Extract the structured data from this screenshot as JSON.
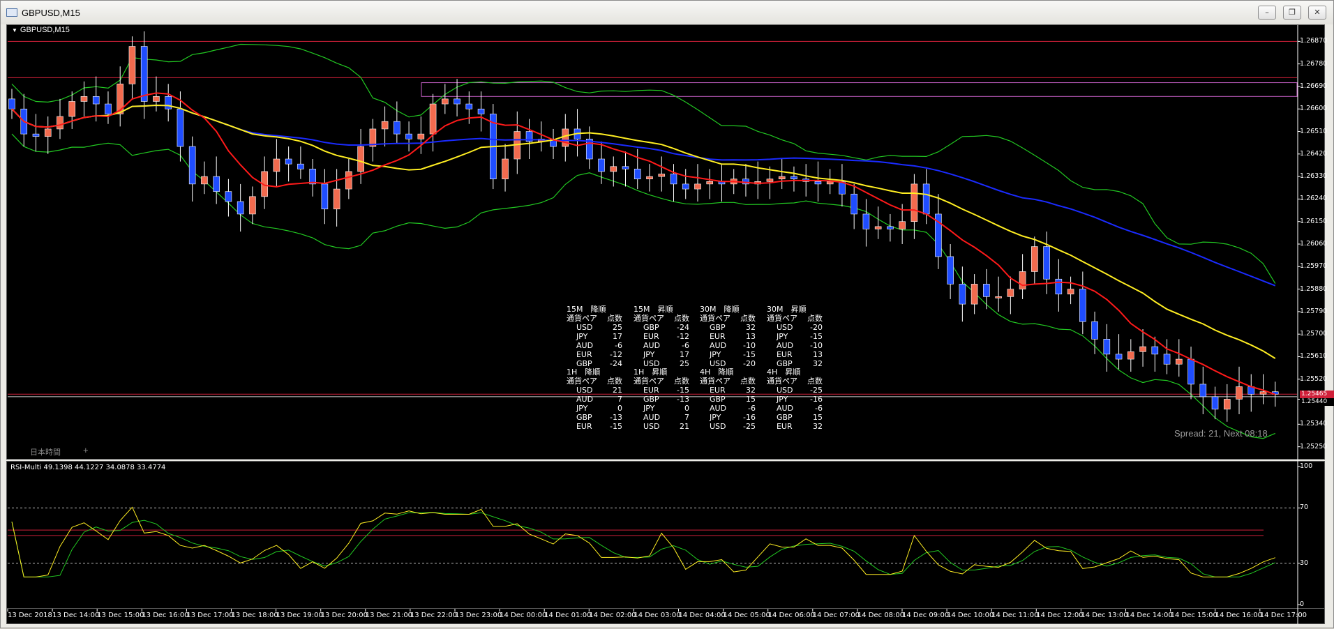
{
  "window": {
    "title": "GBPUSD,M15",
    "buttons": [
      "minimize",
      "restore",
      "close"
    ]
  },
  "chart_label": "GBPUSD,M15",
  "status_bar": {
    "tab": "日本時間",
    "plus": "+"
  },
  "spread_text": "Spread: 21, Next 08:18",
  "price_scale": [
    "1.26870",
    "1.26780",
    "1.26690",
    "1.26600",
    "1.26510",
    "1.26420",
    "1.26330",
    "1.26240",
    "1.26150",
    "1.26060",
    "1.25970",
    "1.25880",
    "1.25790",
    "1.25700",
    "1.25610",
    "1.25520",
    "1.25440",
    "1.25340",
    "1.25250"
  ],
  "price_tags": {
    "current": "1.25465",
    "bid": "1.25440"
  },
  "rsi_label": "RSI-Multi 49.1398 44.1227 34.0878 33.4774",
  "rsi_scale": [
    "100",
    "70",
    "30",
    "0"
  ],
  "time_axis": [
    "13 Dec 2018",
    "13 Dec 14:00",
    "13 Dec 15:00",
    "13 Dec 16:00",
    "13 Dec 17:00",
    "13 Dec 18:00",
    "13 Dec 19:00",
    "13 Dec 20:00",
    "13 Dec 21:00",
    "13 Dec 22:00",
    "13 Dec 23:00",
    "14 Dec 00:00",
    "14 Dec 01:00",
    "14 Dec 02:00",
    "14 Dec 03:00",
    "14 Dec 04:00",
    "14 Dec 05:00",
    "14 Dec 06:00",
    "14 Dec 07:00",
    "14 Dec 08:00",
    "14 Dec 09:00",
    "14 Dec 10:00",
    "14 Dec 11:00",
    "14 Dec 12:00",
    "14 Dec 13:00",
    "14 Dec 14:00",
    "14 Dec 15:00",
    "14 Dec 16:00",
    "14 Dec 17:00"
  ],
  "strength_tables": [
    {
      "title": "15M　降順",
      "h1": "通貨ペア",
      "h2": "点数",
      "rows": [
        [
          "USD",
          "25"
        ],
        [
          "JPY",
          "17"
        ],
        [
          "AUD",
          "-6"
        ],
        [
          "EUR",
          "-12"
        ],
        [
          "GBP",
          "-24"
        ]
      ]
    },
    {
      "title": "15M　昇順",
      "h1": "通貨ペア",
      "h2": "点数",
      "rows": [
        [
          "GBP",
          "-24"
        ],
        [
          "EUR",
          "-12"
        ],
        [
          "AUD",
          "-6"
        ],
        [
          "JPY",
          "17"
        ],
        [
          "USD",
          "25"
        ]
      ]
    },
    {
      "title": "30M　降順",
      "h1": "通貨ペア",
      "h2": "点数",
      "rows": [
        [
          "GBP",
          "32"
        ],
        [
          "EUR",
          "13"
        ],
        [
          "AUD",
          "-10"
        ],
        [
          "JPY",
          "-15"
        ],
        [
          "USD",
          "-20"
        ]
      ]
    },
    {
      "title": "30M　昇順",
      "h1": "通貨ペア",
      "h2": "点数",
      "rows": [
        [
          "USD",
          "-20"
        ],
        [
          "JPY",
          "-15"
        ],
        [
          "AUD",
          "-10"
        ],
        [
          "EUR",
          "13"
        ],
        [
          "GBP",
          "32"
        ]
      ]
    },
    {
      "title": "1H　降順",
      "h1": "通貨ペア",
      "h2": "点数",
      "rows": [
        [
          "USD",
          "21"
        ],
        [
          "AUD",
          "7"
        ],
        [
          "JPY",
          "0"
        ],
        [
          "GBP",
          "-13"
        ],
        [
          "EUR",
          "-15"
        ]
      ]
    },
    {
      "title": "1H　昇順",
      "h1": "通貨ペア",
      "h2": "点数",
      "rows": [
        [
          "EUR",
          "-15"
        ],
        [
          "GBP",
          "-13"
        ],
        [
          "JPY",
          "0"
        ],
        [
          "AUD",
          "7"
        ],
        [
          "USD",
          "21"
        ]
      ]
    },
    {
      "title": "4H　降順",
      "h1": "通貨ペア",
      "h2": "点数",
      "rows": [
        [
          "EUR",
          "32"
        ],
        [
          "GBP",
          "15"
        ],
        [
          "AUD",
          "-6"
        ],
        [
          "JPY",
          "-16"
        ],
        [
          "USD",
          "-25"
        ]
      ]
    },
    {
      "title": "4H　昇順",
      "h1": "通貨ペア",
      "h2": "点数",
      "rows": [
        [
          "USD",
          "-25"
        ],
        [
          "JPY",
          "-16"
        ],
        [
          "AUD",
          "-6"
        ],
        [
          "GBP",
          "15"
        ],
        [
          "EUR",
          "32"
        ]
      ]
    }
  ],
  "colors": {
    "bull": "#f26b4f",
    "bear": "#1f4dff",
    "ma_fast": "#ff1a1a",
    "ma_mid": "#ffee22",
    "ma_slow": "#1a2bff",
    "bands": "#22c922",
    "level": "#d0203a",
    "box": "#c860c8",
    "rsi1": "#ffee22",
    "rsi2": "#22c922"
  },
  "chart_data": {
    "type": "candlestick",
    "symbol": "GBPUSD",
    "timeframe": "M15",
    "ylim": [
      1.2521,
      1.2691
    ],
    "horizontal_levels": [
      1.2687,
      1.26725,
      1.2546,
      1.2545
    ],
    "rsi_levels": [
      70,
      30
    ],
    "closes": [
      1.266,
      1.265,
      1.2649,
      1.2652,
      1.2657,
      1.2663,
      1.2665,
      1.2662,
      1.2658,
      1.267,
      1.2685,
      1.2663,
      1.2665,
      1.266,
      1.2645,
      1.263,
      1.2633,
      1.2627,
      1.2623,
      1.2618,
      1.2625,
      1.2635,
      1.264,
      1.2638,
      1.2636,
      1.263,
      1.262,
      1.2628,
      1.2635,
      1.2645,
      1.2652,
      1.2655,
      1.265,
      1.2648,
      1.265,
      1.2662,
      1.2664,
      1.2662,
      1.266,
      1.2658,
      1.2632,
      1.264,
      1.2651,
      1.2647,
      1.2648,
      1.2645,
      1.2652,
      1.2648,
      1.264,
      1.2635,
      1.2637,
      1.2636,
      1.2632,
      1.2633,
      1.2634,
      1.263,
      1.2628,
      1.263,
      1.2631,
      1.263,
      1.2632,
      1.263,
      1.2631,
      1.2632,
      1.2633,
      1.2632,
      1.2631,
      1.263,
      1.2631,
      1.2626,
      1.2618,
      1.2612,
      1.2613,
      1.2612,
      1.2615,
      1.263,
      1.2618,
      1.2601,
      1.259,
      1.2582,
      1.259,
      1.2585,
      1.2585,
      1.2588,
      1.2595,
      1.2605,
      1.2592,
      1.2586,
      1.2588,
      1.2575,
      1.2568,
      1.2562,
      1.256,
      1.2563,
      1.2565,
      1.2562,
      1.2558,
      1.256,
      1.255,
      1.2545,
      1.254,
      1.2544,
      1.2549,
      1.2546,
      1.2547,
      1.2546
    ]
  }
}
